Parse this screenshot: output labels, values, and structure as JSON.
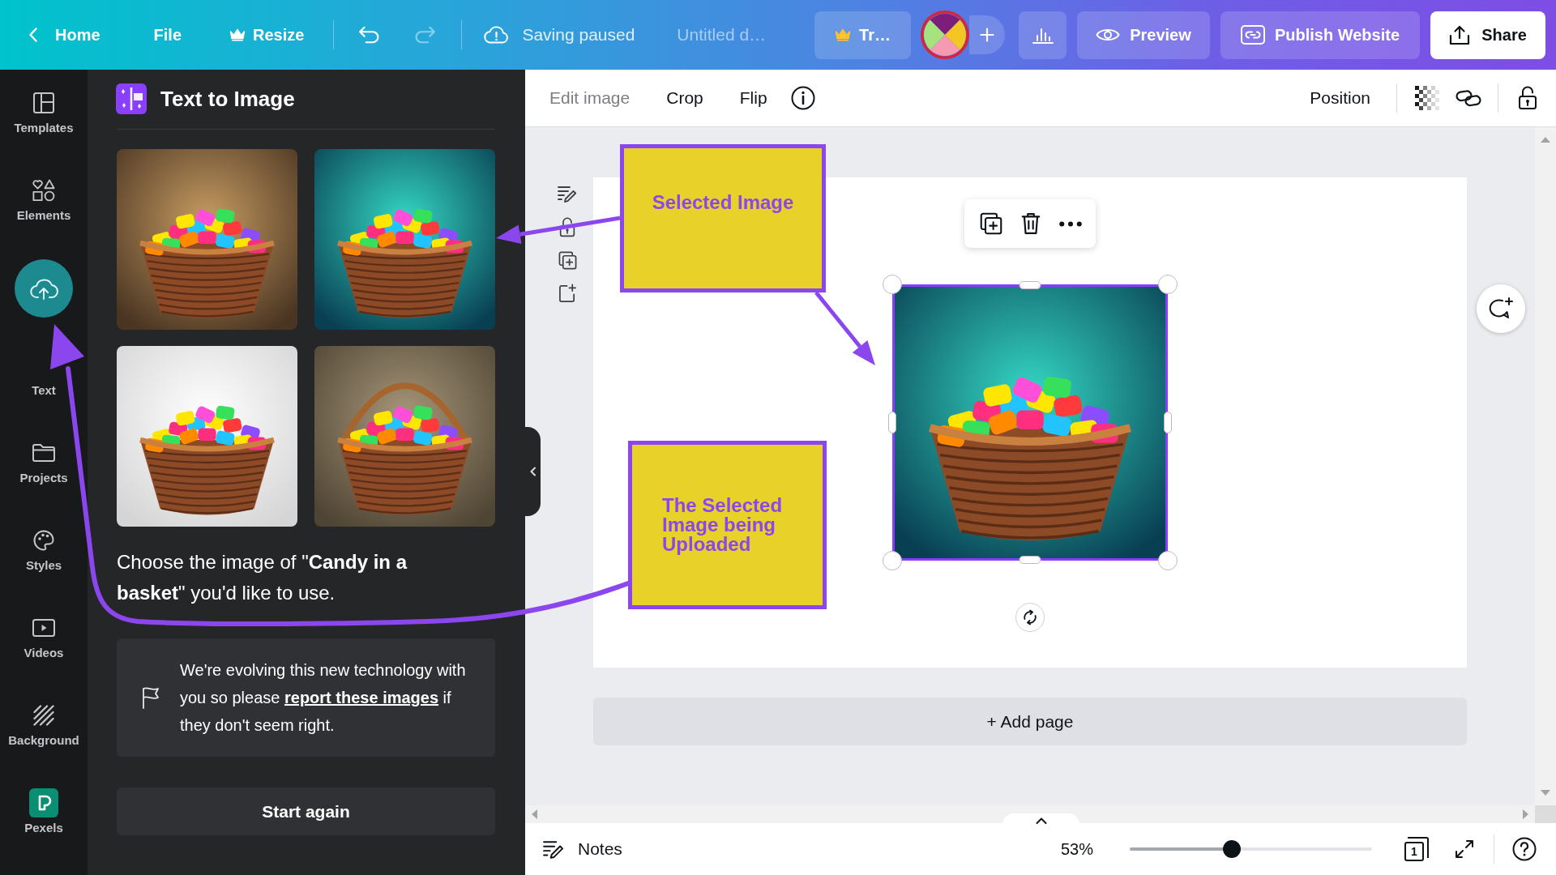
{
  "top_bar": {
    "home": "Home",
    "file": "File",
    "resize": "Resize",
    "history": [
      {
        "kind": "undo",
        "disabled": false
      },
      {
        "kind": "redo",
        "disabled": true
      }
    ],
    "save_status": "Saving paused",
    "document_title": "Untitled d…",
    "trial": "Tr…",
    "preview": "Preview",
    "publish": "Publish Website",
    "share": "Share"
  },
  "sidebar": {
    "items": [
      {
        "kind": "templates",
        "label": "Templates",
        "selected": false
      },
      {
        "kind": "elements",
        "label": "Elements",
        "selected": false
      },
      {
        "kind": "uploads",
        "selected": true
      },
      {
        "kind": "text",
        "label": "Text",
        "selected": false
      },
      {
        "kind": "projects",
        "label": "Projects",
        "selected": false
      },
      {
        "kind": "styles",
        "label": "Styles",
        "selected": false
      },
      {
        "kind": "videos",
        "label": "Videos",
        "selected": false
      },
      {
        "kind": "background",
        "label": "Background",
        "selected": false
      },
      {
        "kind": "pexels",
        "label": "Pexels",
        "selected": false
      }
    ]
  },
  "panel": {
    "title": "Text to Image",
    "prompt": "Choose the image of \"**Candy in a basket**\" you'd like to use.",
    "notice": {
      "before": "We're evolving this new technology with you so please ",
      "link": "report these images",
      "after": " if they don't seem right."
    },
    "button": "Start again"
  },
  "toolbar": {
    "items": [
      {
        "label": "Edit image",
        "disabled": true
      },
      {
        "label": "Crop",
        "disabled": false
      },
      {
        "label": "Flip",
        "disabled": false
      }
    ],
    "position": "Position"
  },
  "page": {
    "add_page": "+ Add page"
  },
  "annotations": [
    {
      "text": "Selected Image"
    },
    {
      "text": "The Selected Image being Uploaded"
    }
  ],
  "bottom_bar": {
    "notes": "Notes",
    "zoom": "53%",
    "zoom_slider": {
      "level": 0.42
    },
    "page_count": "1"
  }
}
